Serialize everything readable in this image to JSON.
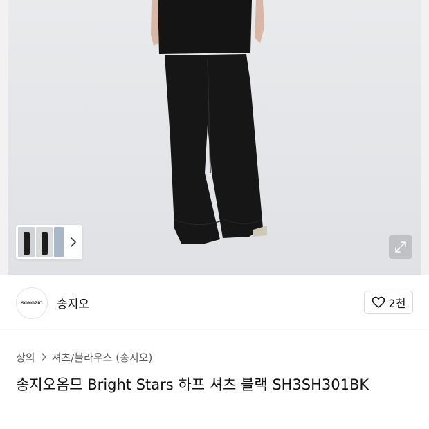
{
  "product_image": {
    "description_icon": "model-photo",
    "thumbnails": [
      "thumb-1",
      "thumb-2",
      "thumb-3"
    ],
    "thumb_more_icon": "chevron-right-icon",
    "expand_icon": "expand-arrows-icon"
  },
  "store": {
    "logo_text": "SONGZIO",
    "name": "송지오",
    "like_icon": "heart-outline-icon",
    "like_count": "2천"
  },
  "breadcrumb": {
    "items": [
      "상의",
      "셔츠/블라우스 (송지오)"
    ],
    "separator_icon": "chevron-right-icon"
  },
  "product": {
    "title": "송지오옴므 Bright Stars 하프 셔츠 블랙 SH3SH301BK"
  },
  "colors": {
    "background": "#ffffff",
    "photo_bg": "#e5e7ea",
    "text": "#111111",
    "muted_text": "#5c5c5c",
    "border": "#d9d9d9"
  }
}
